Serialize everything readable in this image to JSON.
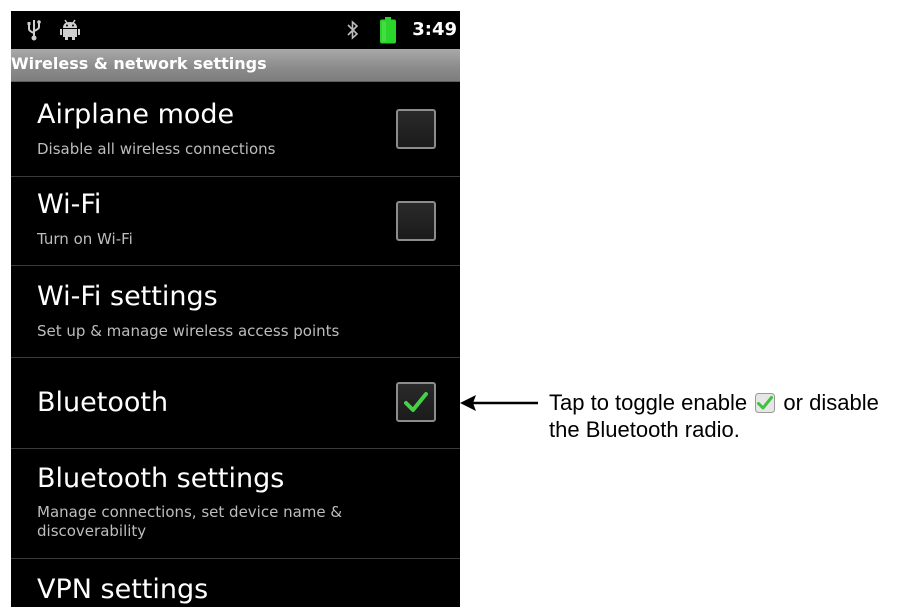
{
  "status_bar": {
    "time": "3:49",
    "icons": [
      "usb-icon",
      "android-icon",
      "bluetooth-icon",
      "battery-icon"
    ],
    "battery_color": "#2bd42b"
  },
  "title_bar": {
    "title": "Wireless & network settings"
  },
  "settings": {
    "airplane": {
      "title": "Airplane mode",
      "summary": "Disable all wireless connections",
      "checked": false
    },
    "wifi": {
      "title": "Wi-Fi",
      "summary": "Turn on Wi-Fi",
      "checked": false
    },
    "wifi_settings": {
      "title": "Wi-Fi settings",
      "summary": "Set up & manage wireless access points"
    },
    "bluetooth": {
      "title": "Bluetooth",
      "checked": true
    },
    "bluetooth_settings": {
      "title": "Bluetooth settings",
      "summary": "Manage connections, set device name & discoverability"
    },
    "vpn_settings": {
      "title": "VPN settings"
    }
  },
  "callout": {
    "text_before": "Tap to toggle enable",
    "text_after": "or disable the Bluetooth radio.",
    "check_color": "#3fc23f"
  }
}
